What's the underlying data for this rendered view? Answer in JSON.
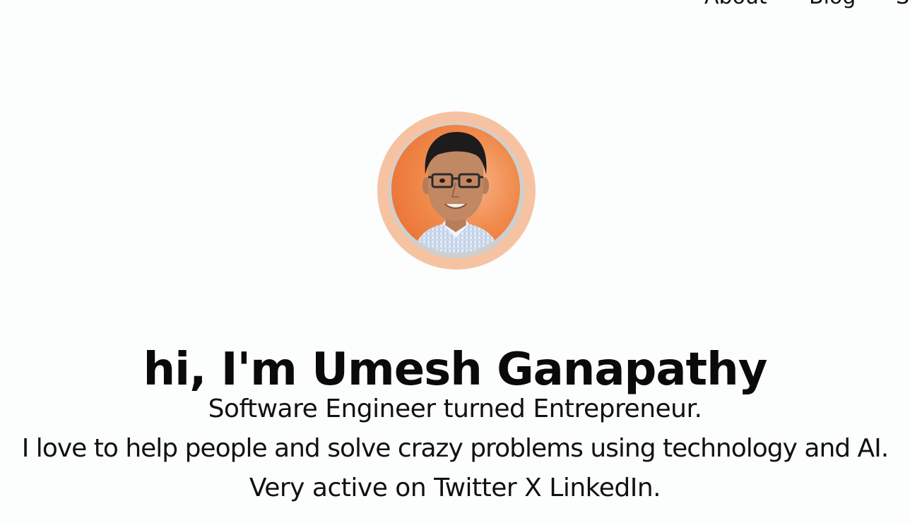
{
  "nav": {
    "items": [
      {
        "label": "About"
      },
      {
        "label": "Blog"
      },
      {
        "label": "S"
      }
    ]
  },
  "hero": {
    "headline": "hi, I'm Umesh Ganapathy",
    "bio": [
      "Software Engineer turned Entrepreneur.",
      "I love to help people and solve crazy problems using technology and AI.",
      "Very active on Twitter X LinkedIn."
    ]
  },
  "colors": {
    "background": "#fcfdfd",
    "avatar_ring": "#f6c3a2",
    "avatar_bg": "#f08a4b",
    "text": "#0b0b0b"
  }
}
